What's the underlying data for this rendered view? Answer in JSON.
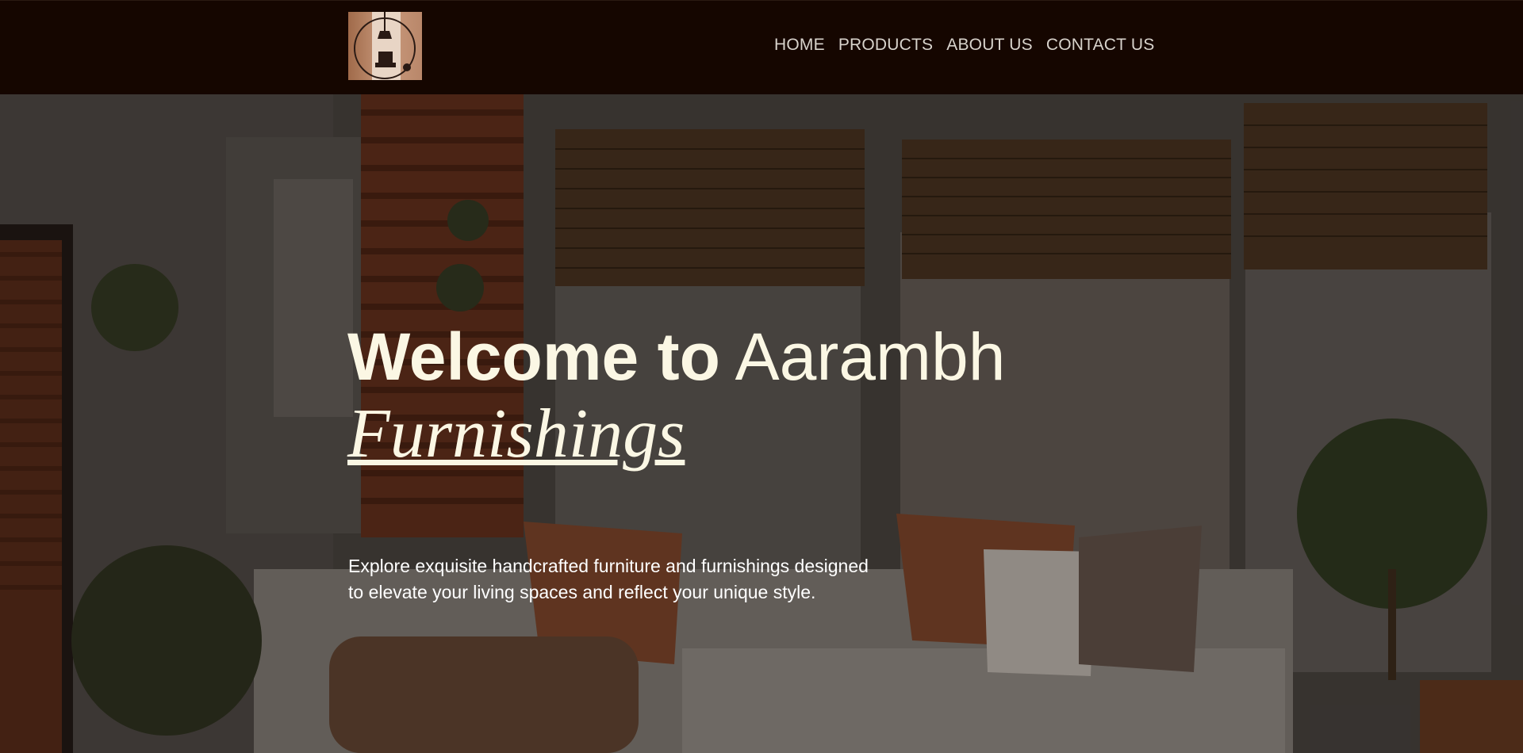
{
  "brand": {
    "logo_icon": "lamp-chair-logo-icon"
  },
  "nav": {
    "items": [
      {
        "label": "HOME"
      },
      {
        "label": "PRODUCTS"
      },
      {
        "label": "ABOUT US"
      },
      {
        "label": "CONTACT US"
      }
    ]
  },
  "hero": {
    "title_bold": "Welcome to",
    "title_regular": "Aarambh",
    "title_italic": "Furnishings",
    "description_line1": "Explore exquisite handcrafted furniture and furnishings designed",
    "description_line2": "to elevate your living spaces and reflect your unique style."
  },
  "colors": {
    "header_bg": "#150600",
    "nav_text": "#d8d3cc",
    "hero_text": "#fbf7e4",
    "accent_wood": "#8a4a2c"
  }
}
